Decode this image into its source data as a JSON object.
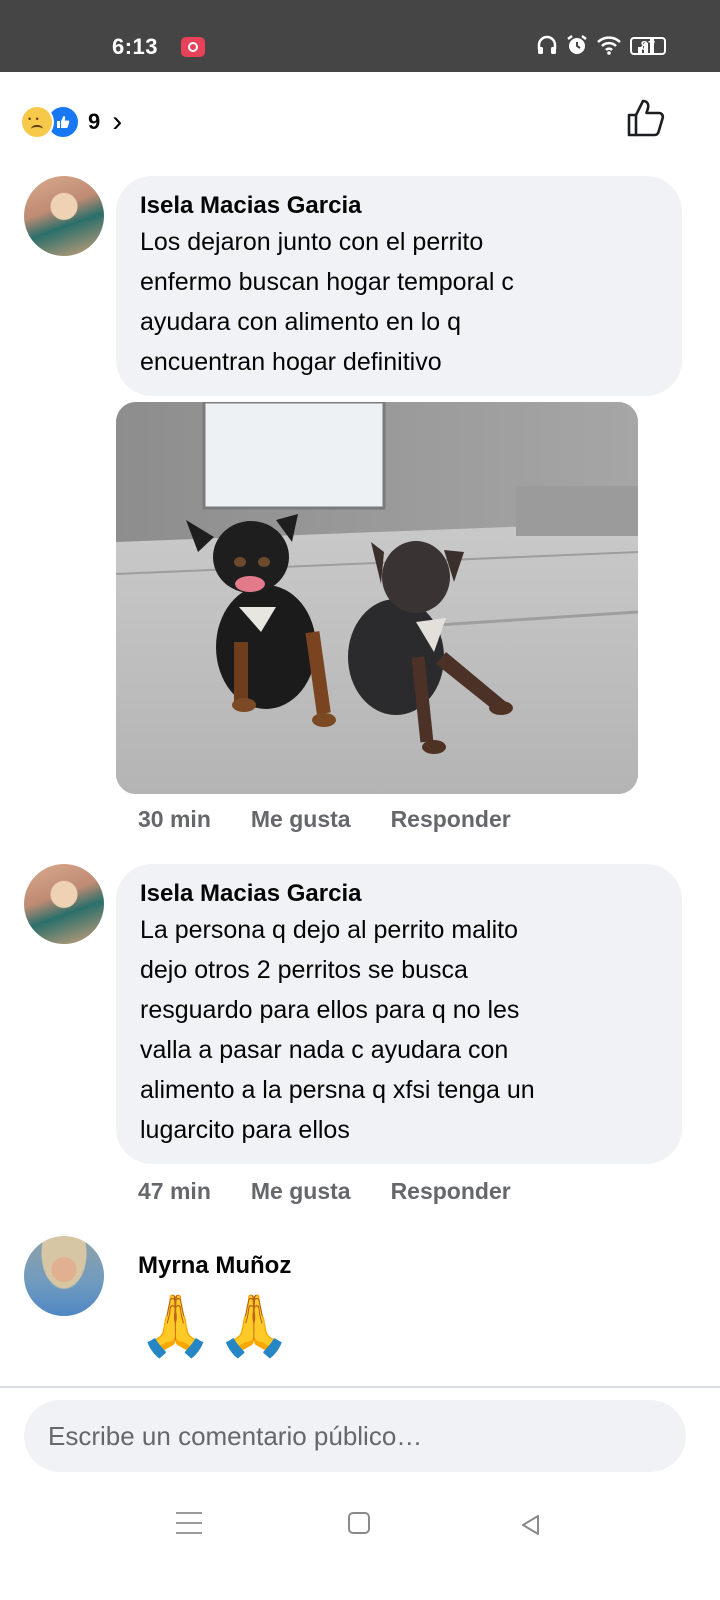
{
  "status_bar": {
    "time": "6:13",
    "battery": "87",
    "icons": [
      "screen-record-icon",
      "headphones-icon",
      "alarm-icon",
      "wifi-icon",
      "signal-icon",
      "battery-icon"
    ]
  },
  "reactions": {
    "types": [
      "sad",
      "like"
    ],
    "count": "9",
    "chevron": "›"
  },
  "comments": [
    {
      "author": "Isela Macias Garcia",
      "text_lines": [
        "Los dejaron junto con el perrito",
        "enfermo buscan hogar temporal c",
        "ayudara con alimento en lo q",
        "encuentran hogar definitivo"
      ],
      "has_photo": true,
      "time": "30 min",
      "like_label": "Me gusta",
      "reply_label": "Responder"
    },
    {
      "author": "Isela Macias Garcia",
      "text_lines": [
        "La persona q dejo al perrito malito",
        "dejo otros 2 perritos se busca",
        "resguardo para ellos para q no les",
        "valla a pasar nada c ayudara con",
        "alimento a la persna q xfsi tenga un",
        "lugarcito para ellos"
      ],
      "time": "47 min",
      "like_label": "Me gusta",
      "reply_label": "Responder"
    },
    {
      "author": "Myrna Muñoz",
      "emoji": "🙏🙏"
    }
  ],
  "composer": {
    "placeholder": "Escribe un comentario público…"
  },
  "colors": {
    "bubble": "#f0f2f5",
    "meta_text": "#65676b",
    "status_bar": "#454545",
    "like_blue": "#1877f2"
  }
}
